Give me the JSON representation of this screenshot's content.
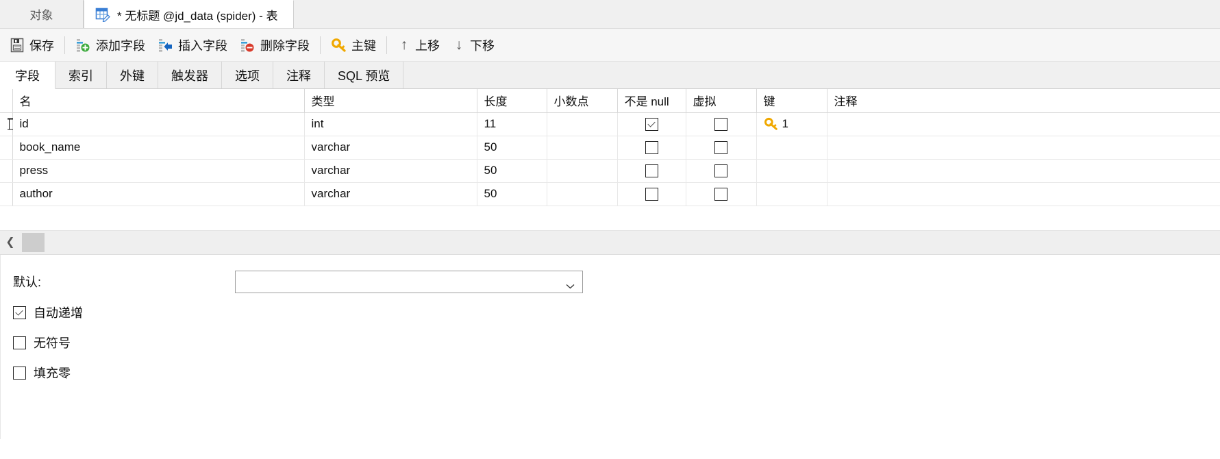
{
  "window_tabs": {
    "object_tab": "对象",
    "active_tab": "* 无标题 @jd_data (spider) - 表",
    "table_icon": "table-designer-icon"
  },
  "toolbar": {
    "buttons": [
      {
        "label": "保存",
        "icon": "save-icon"
      },
      {
        "label": "添加字段",
        "icon": "add-field-icon"
      },
      {
        "label": "插入字段",
        "icon": "insert-field-icon"
      },
      {
        "label": "删除字段",
        "icon": "delete-field-icon"
      },
      {
        "label": "主键",
        "icon": "primary-key-icon"
      },
      {
        "label": "上移",
        "icon": "arrow-up-icon"
      },
      {
        "label": "下移",
        "icon": "arrow-down-icon"
      }
    ]
  },
  "section_tabs": [
    {
      "label": "字段",
      "active": true
    },
    {
      "label": "索引",
      "active": false
    },
    {
      "label": "外键",
      "active": false
    },
    {
      "label": "触发器",
      "active": false
    },
    {
      "label": "选项",
      "active": false
    },
    {
      "label": "注释",
      "active": false
    },
    {
      "label": "SQL 预览",
      "active": false
    }
  ],
  "grid": {
    "columns": [
      "名",
      "类型",
      "长度",
      "小数点",
      "不是 null",
      "虚拟",
      "键",
      "注释"
    ],
    "rows": [
      {
        "name": "id",
        "type": "int",
        "length": "11",
        "decimals": "",
        "not_null": true,
        "virtual": false,
        "key": "1",
        "key_icon": "primary-key-icon",
        "comment": "",
        "selected": true
      },
      {
        "name": "book_name",
        "type": "varchar",
        "length": "50",
        "decimals": "",
        "not_null": false,
        "virtual": false,
        "key": "",
        "key_icon": "",
        "comment": "",
        "selected": false
      },
      {
        "name": "press",
        "type": "varchar",
        "length": "50",
        "decimals": "",
        "not_null": false,
        "virtual": false,
        "key": "",
        "key_icon": "",
        "comment": "",
        "selected": false
      },
      {
        "name": "author",
        "type": "varchar",
        "length": "50",
        "decimals": "",
        "not_null": false,
        "virtual": false,
        "key": "",
        "key_icon": "",
        "comment": "",
        "selected": false
      }
    ]
  },
  "scrollbar": {
    "left_arrow": "❮"
  },
  "detail": {
    "default_label": "默认:",
    "default_value": "",
    "default_placeholder": "",
    "auto_increment": {
      "label": "自动递增",
      "checked": true
    },
    "unsigned": {
      "label": "无符号",
      "checked": false
    },
    "zerofill": {
      "label": "填充零",
      "checked": false
    }
  },
  "colors": {
    "accent_blue": "#3a7fd5",
    "key_gold": "#f0a800",
    "add_green": "#3aa93a",
    "delete_red": "#d93b2b",
    "toolbar_bg": "#f6f6f6",
    "tab_bg": "#f0f0f0"
  }
}
